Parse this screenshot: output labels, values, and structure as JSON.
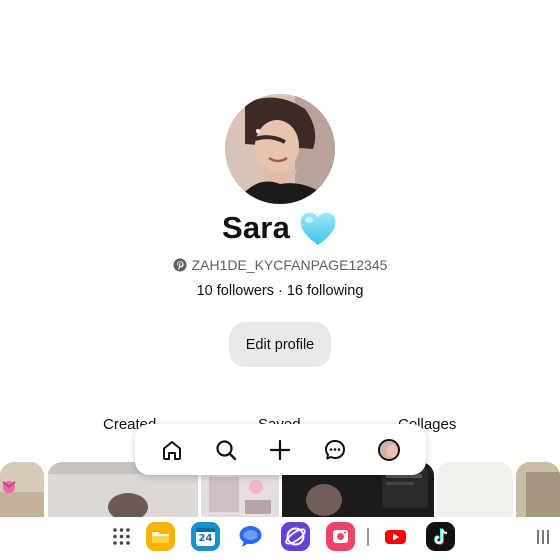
{
  "profile": {
    "name": "Sara",
    "heart_icon": "light-blue-heart-emoji",
    "username": "ZAH1DE_KYCFANPAGE12345",
    "followers": "10 followers",
    "separator": "·",
    "following": "16 following",
    "edit_label": "Edit profile"
  },
  "tabs": [
    {
      "label": "Created"
    },
    {
      "label": "Saved"
    },
    {
      "label": "Collages"
    }
  ],
  "bottom_nav": {
    "items": [
      "home-icon",
      "search-icon",
      "plus-icon",
      "messages-icon",
      "profile-avatar-icon"
    ]
  },
  "taskbar": {
    "calendar_date": "24",
    "apps": [
      "app-drawer-icon",
      "files-app-icon",
      "calendar-app-icon",
      "messages-app-icon",
      "internet-app-icon",
      "screen-recorder-app-icon",
      "youtube-app-icon",
      "tiktok-app-icon",
      "recents-icon"
    ]
  },
  "colors": {
    "edit_button_bg": "#e9e9e9",
    "heart": "#6cd4f2",
    "text_primary": "#111111",
    "text_secondary": "#5f5f5f"
  }
}
